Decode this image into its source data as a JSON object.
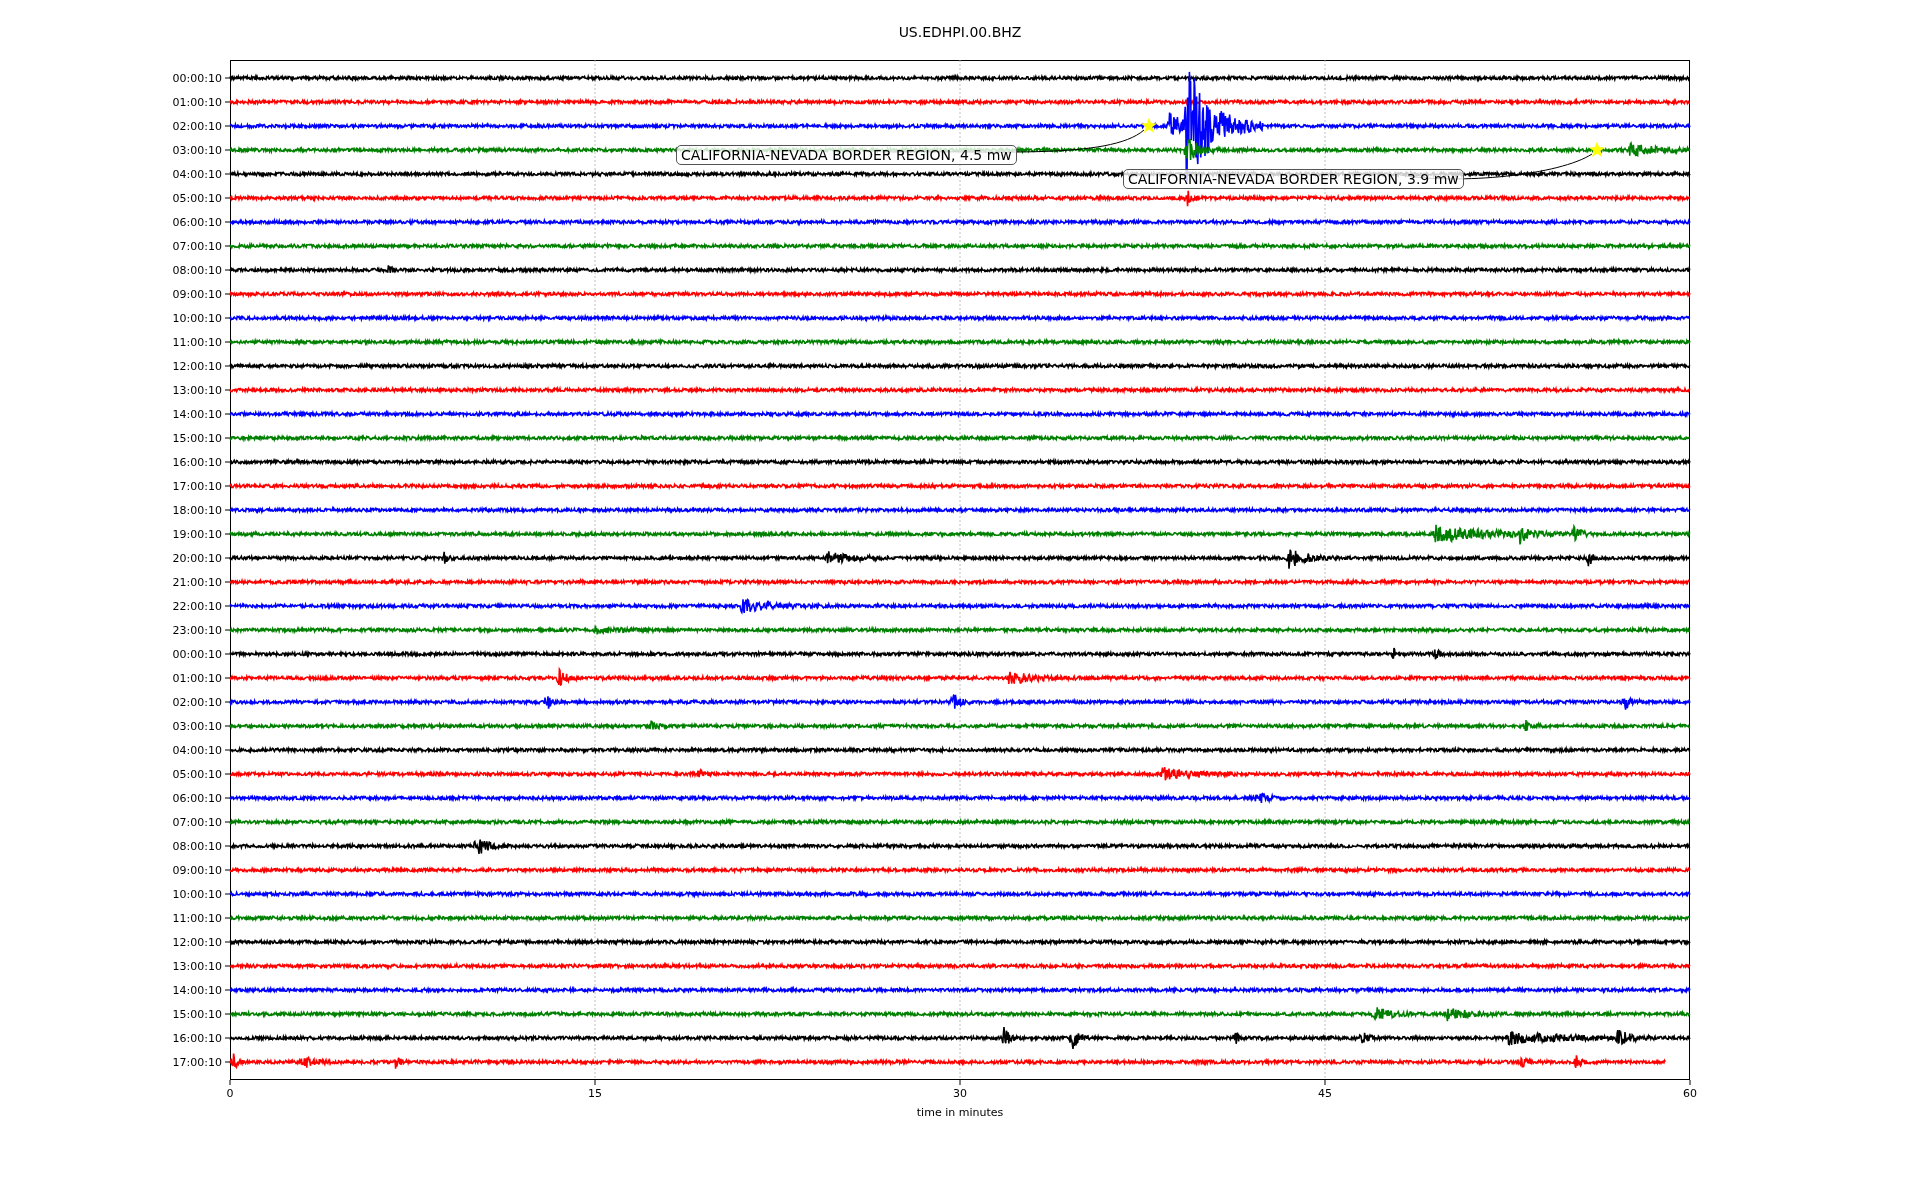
{
  "title": "US.EDHPI.00.BHZ",
  "rows": [
    {
      "label": "00:00:10",
      "color": "#000000"
    },
    {
      "label": "01:00:10",
      "color": "#ff0000"
    },
    {
      "label": "02:00:10",
      "color": "#0000ff"
    },
    {
      "label": "03:00:10",
      "color": "#008000"
    },
    {
      "label": "04:00:10",
      "color": "#000000"
    },
    {
      "label": "05:00:10",
      "color": "#ff0000"
    },
    {
      "label": "06:00:10",
      "color": "#0000ff"
    },
    {
      "label": "07:00:10",
      "color": "#008000"
    },
    {
      "label": "08:00:10",
      "color": "#000000"
    },
    {
      "label": "09:00:10",
      "color": "#ff0000"
    },
    {
      "label": "10:00:10",
      "color": "#0000ff"
    },
    {
      "label": "11:00:10",
      "color": "#008000"
    },
    {
      "label": "12:00:10",
      "color": "#000000"
    },
    {
      "label": "13:00:10",
      "color": "#ff0000"
    },
    {
      "label": "14:00:10",
      "color": "#0000ff"
    },
    {
      "label": "15:00:10",
      "color": "#008000"
    },
    {
      "label": "16:00:10",
      "color": "#000000"
    },
    {
      "label": "17:00:10",
      "color": "#ff0000"
    },
    {
      "label": "18:00:10",
      "color": "#0000ff"
    },
    {
      "label": "19:00:10",
      "color": "#008000"
    },
    {
      "label": "20:00:10",
      "color": "#000000"
    },
    {
      "label": "21:00:10",
      "color": "#ff0000"
    },
    {
      "label": "22:00:10",
      "color": "#0000ff"
    },
    {
      "label": "23:00:10",
      "color": "#008000"
    },
    {
      "label": "00:00:10",
      "color": "#000000"
    },
    {
      "label": "01:00:10",
      "color": "#ff0000"
    },
    {
      "label": "02:00:10",
      "color": "#0000ff"
    },
    {
      "label": "03:00:10",
      "color": "#008000"
    },
    {
      "label": "04:00:10",
      "color": "#000000"
    },
    {
      "label": "05:00:10",
      "color": "#ff0000"
    },
    {
      "label": "06:00:10",
      "color": "#0000ff"
    },
    {
      "label": "07:00:10",
      "color": "#008000"
    },
    {
      "label": "08:00:10",
      "color": "#000000"
    },
    {
      "label": "09:00:10",
      "color": "#ff0000"
    },
    {
      "label": "10:00:10",
      "color": "#0000ff"
    },
    {
      "label": "11:00:10",
      "color": "#008000"
    },
    {
      "label": "12:00:10",
      "color": "#000000"
    },
    {
      "label": "13:00:10",
      "color": "#ff0000"
    },
    {
      "label": "14:00:10",
      "color": "#0000ff"
    },
    {
      "label": "15:00:10",
      "color": "#008000"
    },
    {
      "label": "16:00:10",
      "color": "#000000"
    },
    {
      "label": "17:00:10",
      "color": "#ff0000"
    }
  ],
  "xticks": [
    "0",
    "15",
    "30",
    "45",
    "60"
  ],
  "xlabel": "time in minutes",
  "annotations": [
    {
      "text": "CALIFORNIA-NEVADA BORDER REGION, 4.5 mw"
    },
    {
      "text": "CALIFORNIA-NEVADA BORDER REGION, 3.9 mw"
    }
  ]
}
